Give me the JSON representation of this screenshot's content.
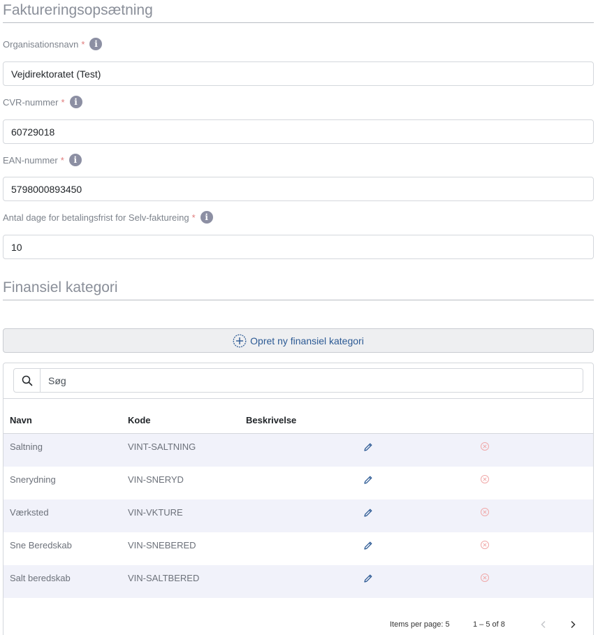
{
  "billing_setup": {
    "title": "Faktureringsopsætning",
    "fields": [
      {
        "label": "Organisationsnavn",
        "value": "Vejdirektoratet (Test)"
      },
      {
        "label": "CVR-nummer",
        "value": "60729018"
      },
      {
        "label": "EAN-nummer",
        "value": "5798000893450"
      },
      {
        "label": "Antal dage for betalingsfrist for Selv-faktureing",
        "value": "10"
      }
    ],
    "required_marker": "*"
  },
  "financial_category": {
    "title": "Finansiel kategori",
    "add_button_label": "Opret ny finansiel kategori",
    "search": {
      "placeholder": "Søg"
    },
    "columns": [
      "Navn",
      "Kode",
      "Beskrivelse"
    ],
    "rows": [
      {
        "name": "Saltning",
        "code": "VINT-SALTNING",
        "description": ""
      },
      {
        "name": "Snerydning",
        "code": "VIN-SNERYD",
        "description": ""
      },
      {
        "name": "Værksted",
        "code": "VIN-VKTURE",
        "description": ""
      },
      {
        "name": "Sne Beredskab",
        "code": "VIN-SNEBERED",
        "description": ""
      },
      {
        "name": "Salt beredskab",
        "code": "VIN-SALTBERED",
        "description": ""
      }
    ],
    "paginator": {
      "items_per_page_label": "Items per page:",
      "items_per_page": "5",
      "range": "1 – 5 of 8"
    }
  },
  "colors": {
    "accent": "#2c5a94",
    "required": "#e07b7b",
    "delete": "#f0a8a8",
    "row_stripe": "#f1f2fa"
  }
}
